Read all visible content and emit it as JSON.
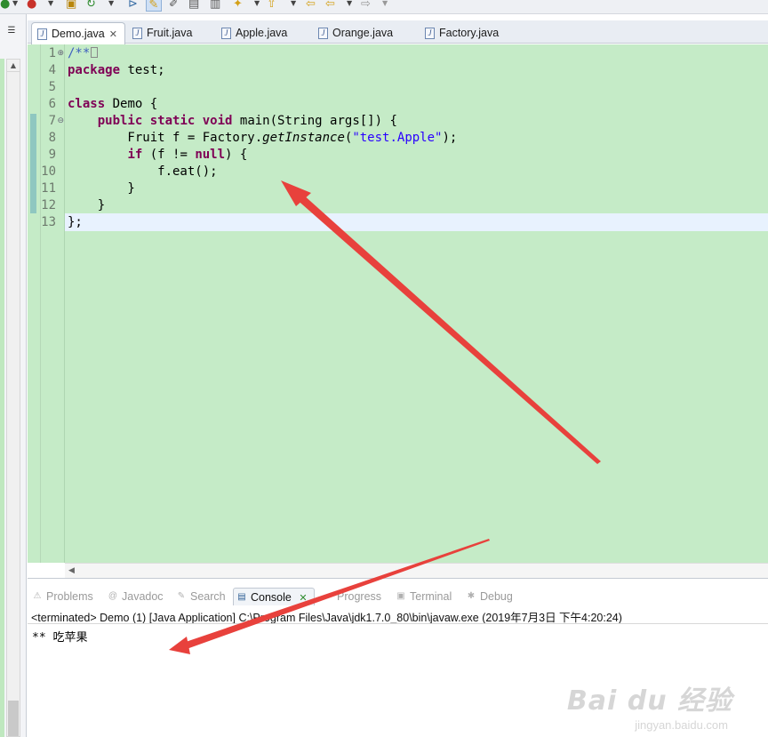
{
  "toolbar": {
    "icons": [
      "run-icon",
      "coverage-icon",
      "refresh-icon",
      "package-icon",
      "highlight-icon",
      "pen-icon",
      "doc-icon",
      "table-icon",
      "bulb-icon",
      "arrow-up-icon",
      "back-icon",
      "forward-icon",
      "next-icon"
    ]
  },
  "editor_tabs": [
    {
      "label": "Demo.java",
      "active": true
    },
    {
      "label": "Fruit.java",
      "active": false
    },
    {
      "label": "Apple.java",
      "active": false
    },
    {
      "label": "Orange.java",
      "active": false
    },
    {
      "label": "Factory.java",
      "active": false
    }
  ],
  "editor": {
    "line_numbers": [
      "1",
      "4",
      "5",
      "6",
      "7",
      "8",
      "9",
      "10",
      "11",
      "12",
      "13"
    ],
    "lines": {
      "l1_comment": "/**",
      "l4_kw": "package",
      "l4_rest": " test;",
      "l6_kw": "class",
      "l6_rest": " Demo {",
      "l7_indent": "    ",
      "l7_kw1": "public",
      "l7_kw2": "static",
      "l7_kw3": "void",
      "l7_rest": " main(String args[]) {",
      "l8_a": "        Fruit f = Factory.",
      "l8_method": "getInstance",
      "l8_b": "(",
      "l8_str": "\"test.Apple\"",
      "l8_c": ");",
      "l9_indent": "        ",
      "l9_kw1": "if",
      "l9_a": " (f != ",
      "l9_kw2": "null",
      "l9_b": ") {",
      "l10": "            f.eat();",
      "l11": "        }",
      "l12": "    }",
      "l13": "};"
    }
  },
  "bottom_tabs": [
    {
      "label": "Problems",
      "icon": "problems-icon",
      "active": false
    },
    {
      "label": "Javadoc",
      "icon": "javadoc-icon",
      "active": false
    },
    {
      "label": "Search",
      "icon": "search-icon",
      "active": false
    },
    {
      "label": "Console",
      "icon": "console-icon",
      "active": true
    },
    {
      "label": "Progress",
      "icon": "progress-icon",
      "active": false
    },
    {
      "label": "Terminal",
      "icon": "terminal-icon",
      "active": false
    },
    {
      "label": "Debug",
      "icon": "debug-icon",
      "active": false
    }
  ],
  "console": {
    "status": "<terminated> Demo (1) [Java Application] C:\\Program Files\\Java\\jdk1.7.0_80\\bin\\javaw.exe (2019年7月3日 下午4:20:24)",
    "output": "** 吃苹果"
  },
  "watermark": {
    "brand": "Bai du 经验",
    "url": "jingyan.baidu.com"
  },
  "annotation_colors": {
    "arrow": "#e8413c"
  }
}
